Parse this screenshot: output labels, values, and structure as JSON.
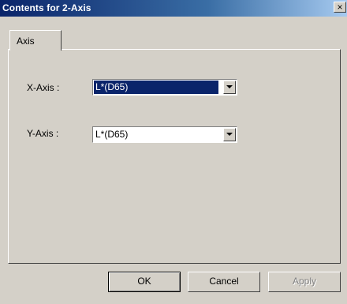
{
  "window": {
    "title": "Contents for 2-Axis",
    "close_glyph": "×"
  },
  "tabs": [
    {
      "label": "Axis",
      "selected": true
    }
  ],
  "fields": {
    "x_axis": {
      "label": "X-Axis :",
      "value": "L*(D65)",
      "focused": true
    },
    "y_axis": {
      "label": "Y-Axis :",
      "value": "L*(D65)",
      "focused": false
    }
  },
  "buttons": {
    "ok": "OK",
    "cancel": "Cancel",
    "apply": "Apply",
    "apply_enabled": false
  },
  "colors": {
    "title_bar": "#0a246a",
    "dialog_face": "#d4d0c8",
    "selection": "#0a246a"
  }
}
